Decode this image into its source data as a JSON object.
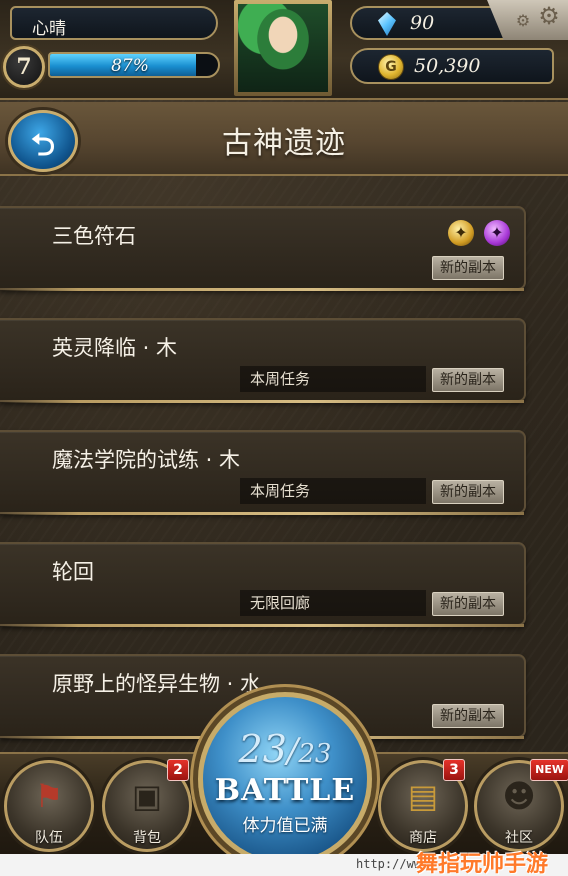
{
  "hud": {
    "player_name": "心晴",
    "level": "7",
    "exp_text": "87%",
    "exp_fraction": 0.87,
    "gems": "90",
    "gold": "50,390",
    "gold_symbol": "G",
    "icons": {
      "gem": "gem-icon",
      "gold": "gold-coin-icon",
      "settings": "gear-icon"
    }
  },
  "header": {
    "title": "古神遗迹",
    "back_symbol": "⮌"
  },
  "dungeons": [
    {
      "name": "三色符石",
      "subtitle": "",
      "badge": "新的副本",
      "has_runes": true
    },
    {
      "name": "英灵降临 · 木",
      "subtitle": "本周任务",
      "badge": "新的副本",
      "has_runes": false
    },
    {
      "name": "魔法学院的试练 · 木",
      "subtitle": "本周任务",
      "badge": "新的副本",
      "has_runes": false
    },
    {
      "name": "轮回",
      "subtitle": "无限回廊",
      "badge": "新的副本",
      "has_runes": false
    },
    {
      "name": "原野上的怪异生物 · 水",
      "subtitle": "",
      "badge": "新的副本",
      "has_runes": false
    }
  ],
  "nav": {
    "team": {
      "label": "队伍",
      "badge": ""
    },
    "bag": {
      "label": "背包",
      "badge": "2"
    },
    "shop": {
      "label": "商店",
      "badge": "3"
    },
    "community": {
      "label": "社区",
      "badge": "NEW"
    }
  },
  "battle": {
    "stamina_current": "23",
    "stamina_sep": "/",
    "stamina_max": "23",
    "label": "BATTLE",
    "status": "体力值已满"
  },
  "footer": {
    "url": "http://www.",
    "watermark": "舞指玩帅手游网"
  },
  "colors": {
    "accent_gold": "#c9ad6e",
    "exp_blue": "#1a8fd0",
    "badge_red": "#e5322a",
    "battle_blue": "#3f90c9"
  }
}
